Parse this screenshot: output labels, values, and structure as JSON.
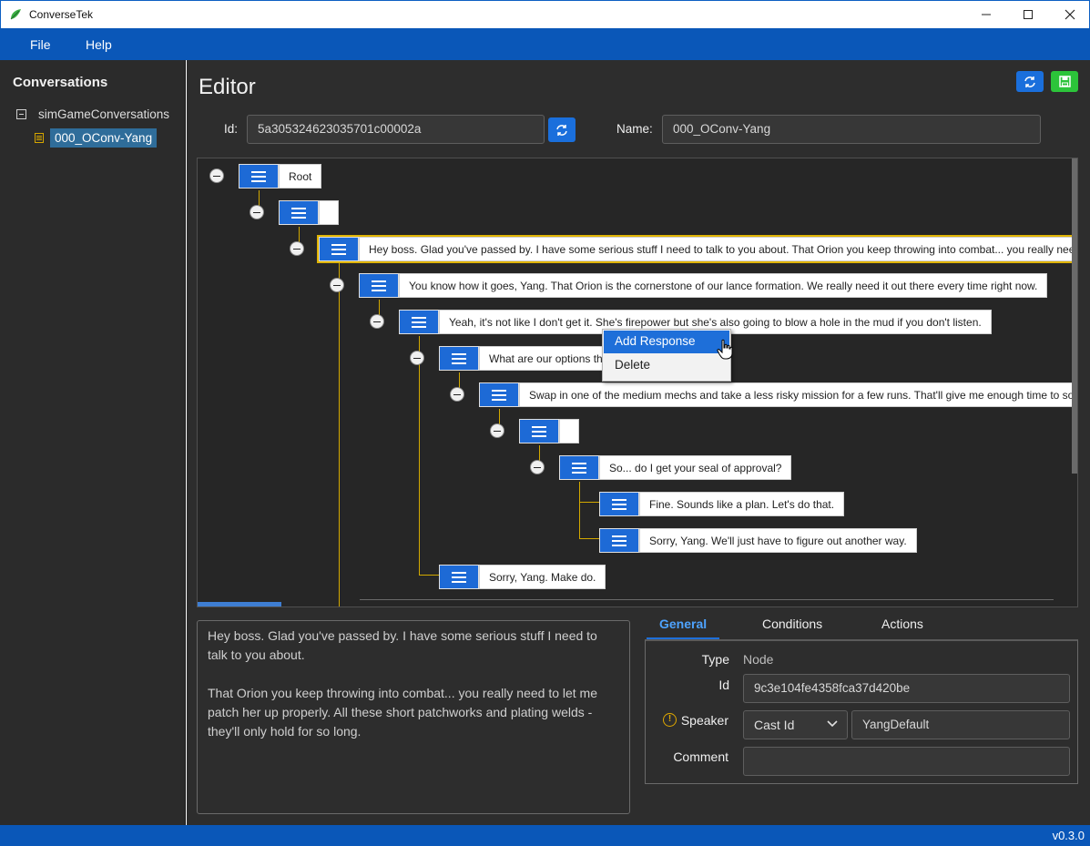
{
  "window": {
    "title": "ConverseTek"
  },
  "menu": {
    "file": "File",
    "help": "Help"
  },
  "sidebar": {
    "heading": "Conversations",
    "tree_root": "simGameConversations",
    "tree_child": "000_OConv-Yang"
  },
  "editor": {
    "title": "Editor",
    "id_label": "Id",
    "id_value": "5a305324623035701c00002a",
    "name_label": "Name",
    "name_value": "000_OConv-Yang"
  },
  "nodes": {
    "root": "Root",
    "n2": "",
    "n3": "Hey boss. Glad you've passed by. I have some serious stuff I need to talk to you about. That Orion you keep throwing into combat... you really need",
    "n4": "You know how it goes, Yang. That Orion is the cornerstone of our lance formation. We really need it out there every time right now.",
    "n5": "Yeah, it's not like I don't get it. She's firepower but she's also going to blow a hole in the mud if you don't listen.",
    "n6": "What are our options th",
    "n7": "Swap in one of the medium mechs and take a less risky mission for a few runs. That'll give me enough time to sor",
    "n8": "",
    "n9": "So... do I get your seal of approval?",
    "n10": "Fine. Sounds like a plan. Let's do that.",
    "n11": "Sorry, Yang. We'll just have to figure out another way.",
    "n12": "Sorry, Yang. Make do."
  },
  "context_menu": {
    "add_response": "Add Response",
    "delete": "Delete"
  },
  "node_text": "Hey boss. Glad you've passed by. I have some serious stuff I need to talk to you about.\n\nThat Orion you keep throwing into combat... you really need to let me patch her up properly. All these short patchworks and plating welds - they'll only hold for so long.",
  "tabs": {
    "general": "General",
    "conditions": "Conditions",
    "actions": "Actions"
  },
  "properties": {
    "type_label": "Type",
    "type_value": "Node",
    "id_label": "Id",
    "id_value": "9c3e104fe4358fca37d420be",
    "speaker_label": "Speaker",
    "speaker_type": "Cast Id",
    "speaker_value": "YangDefault",
    "comment_label": "Comment",
    "comment_value": ""
  },
  "status": {
    "version": "v0.3.0"
  },
  "colors": {
    "accent": "#0a57b8",
    "tree_line": "#d3a900",
    "save": "#2cc43a"
  }
}
